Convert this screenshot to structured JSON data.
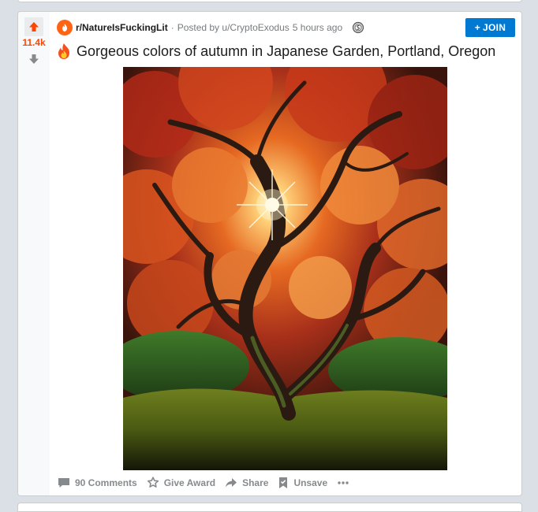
{
  "post": {
    "score": "11.4k",
    "subreddit": "r/NatureIsFuckingLit",
    "separator": "·",
    "posted_by": "Posted by u/CryptoExodus",
    "time_ago": "5 hours ago",
    "join_label": "JOIN",
    "join_plus": "+",
    "title": "Gorgeous colors of autumn in Japanese Garden, Portland, Oregon",
    "title_emoji": "fire-icon",
    "image_subject": "Japanese maple tree with red and orange autumn leaves, sunburst through branches, moss-covered ground"
  },
  "actions": {
    "comments": "90 Comments",
    "award": "Give Award",
    "share": "Share",
    "save": "Unsave"
  },
  "colors": {
    "upvote_active": "#ff4500",
    "join_button": "#0079d3",
    "meta_text": "#787c7e",
    "action_text": "#878a8c"
  },
  "icons": [
    "upvote-icon",
    "downvote-icon",
    "subreddit-icon",
    "award-badge-icon",
    "fire-icon",
    "comment-icon",
    "award-icon",
    "share-icon",
    "save-icon",
    "more-icon"
  ]
}
